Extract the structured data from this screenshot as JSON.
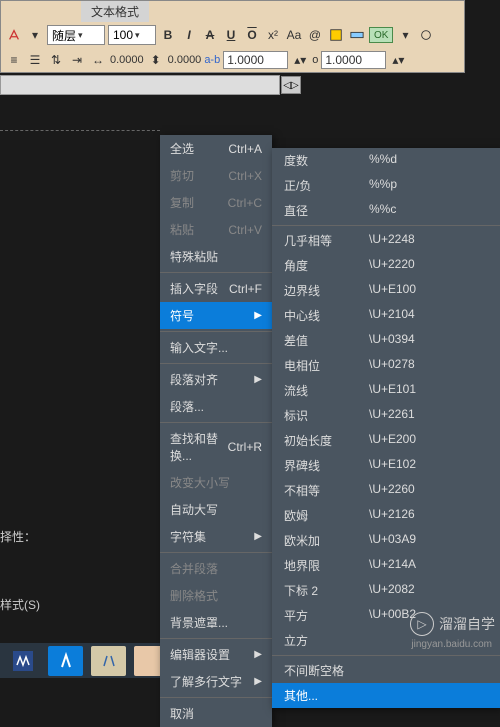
{
  "tab": {
    "label": "文本格式"
  },
  "toolbar": {
    "layer": "随层",
    "size": "100",
    "bold": "B",
    "italic": "I",
    "strike": "A",
    "underline": "U",
    "overline": "O",
    "ok": "OK",
    "row2": {
      "val1": "0.0000",
      "val2": "0.0000",
      "ab_label": "a-b",
      "val3": "1.0000",
      "o_label": "o",
      "val4": "1.0000"
    }
  },
  "menu": {
    "items": [
      {
        "label": "全选",
        "shortcut": "Ctrl+A"
      },
      {
        "label": "剪切",
        "shortcut": "Ctrl+X",
        "disabled": true
      },
      {
        "label": "复制",
        "shortcut": "Ctrl+C",
        "disabled": true
      },
      {
        "label": "粘贴",
        "shortcut": "Ctrl+V",
        "disabled": true
      },
      {
        "label": "特殊粘贴"
      },
      {
        "sep": true
      },
      {
        "label": "插入字段",
        "shortcut": "Ctrl+F"
      },
      {
        "label": "符号",
        "selected": true,
        "submenu": true
      },
      {
        "sep": true
      },
      {
        "label": "输入文字..."
      },
      {
        "sep": true
      },
      {
        "label": "段落对齐",
        "submenu": true
      },
      {
        "label": "段落..."
      },
      {
        "sep": true
      },
      {
        "label": "查找和替换...",
        "shortcut": "Ctrl+R"
      },
      {
        "label": "改变大小写",
        "disabled": true
      },
      {
        "label": "自动大写"
      },
      {
        "label": "字符集",
        "submenu": true
      },
      {
        "sep": true
      },
      {
        "label": "合并段落",
        "disabled": true
      },
      {
        "label": "删除格式",
        "disabled": true
      },
      {
        "label": "背景遮罩..."
      },
      {
        "sep": true
      },
      {
        "label": "编辑器设置",
        "submenu": true
      },
      {
        "label": "了解多行文字",
        "submenu": true
      },
      {
        "sep": true
      },
      {
        "label": "取消"
      }
    ]
  },
  "submenu": {
    "items": [
      {
        "label": "度数",
        "code": "%%d"
      },
      {
        "label": "正/负",
        "code": "%%p"
      },
      {
        "label": "直径",
        "code": "%%c"
      },
      {
        "sep": true
      },
      {
        "label": "几乎相等",
        "code": "\\U+2248"
      },
      {
        "label": "角度",
        "code": "\\U+2220"
      },
      {
        "label": "边界线",
        "code": "\\U+E100"
      },
      {
        "label": "中心线",
        "code": "\\U+2104"
      },
      {
        "label": "差值",
        "code": "\\U+0394"
      },
      {
        "label": "电相位",
        "code": "\\U+0278"
      },
      {
        "label": "流线",
        "code": "\\U+E101"
      },
      {
        "label": "标识",
        "code": "\\U+2261"
      },
      {
        "label": "初始长度",
        "code": "\\U+E200"
      },
      {
        "label": "界碑线",
        "code": "\\U+E102"
      },
      {
        "label": "不相等",
        "code": "\\U+2260"
      },
      {
        "label": "欧姆",
        "code": "\\U+2126"
      },
      {
        "label": "欧米加",
        "code": "\\U+03A9"
      },
      {
        "label": "地界限",
        "code": "\\U+214A"
      },
      {
        "label": "下标 2",
        "code": "\\U+2082"
      },
      {
        "label": "平方",
        "code": "\\U+00B2"
      },
      {
        "label": "立方",
        "code": ""
      },
      {
        "sep": true
      },
      {
        "label": "不间断空格"
      },
      {
        "label": "其他...",
        "selected": true
      }
    ]
  },
  "labels": {
    "prop": "择性：",
    "style": "样式(S)"
  },
  "watermark": {
    "text": "溜溜自学",
    "sub": "jingyan.baidu.com"
  }
}
